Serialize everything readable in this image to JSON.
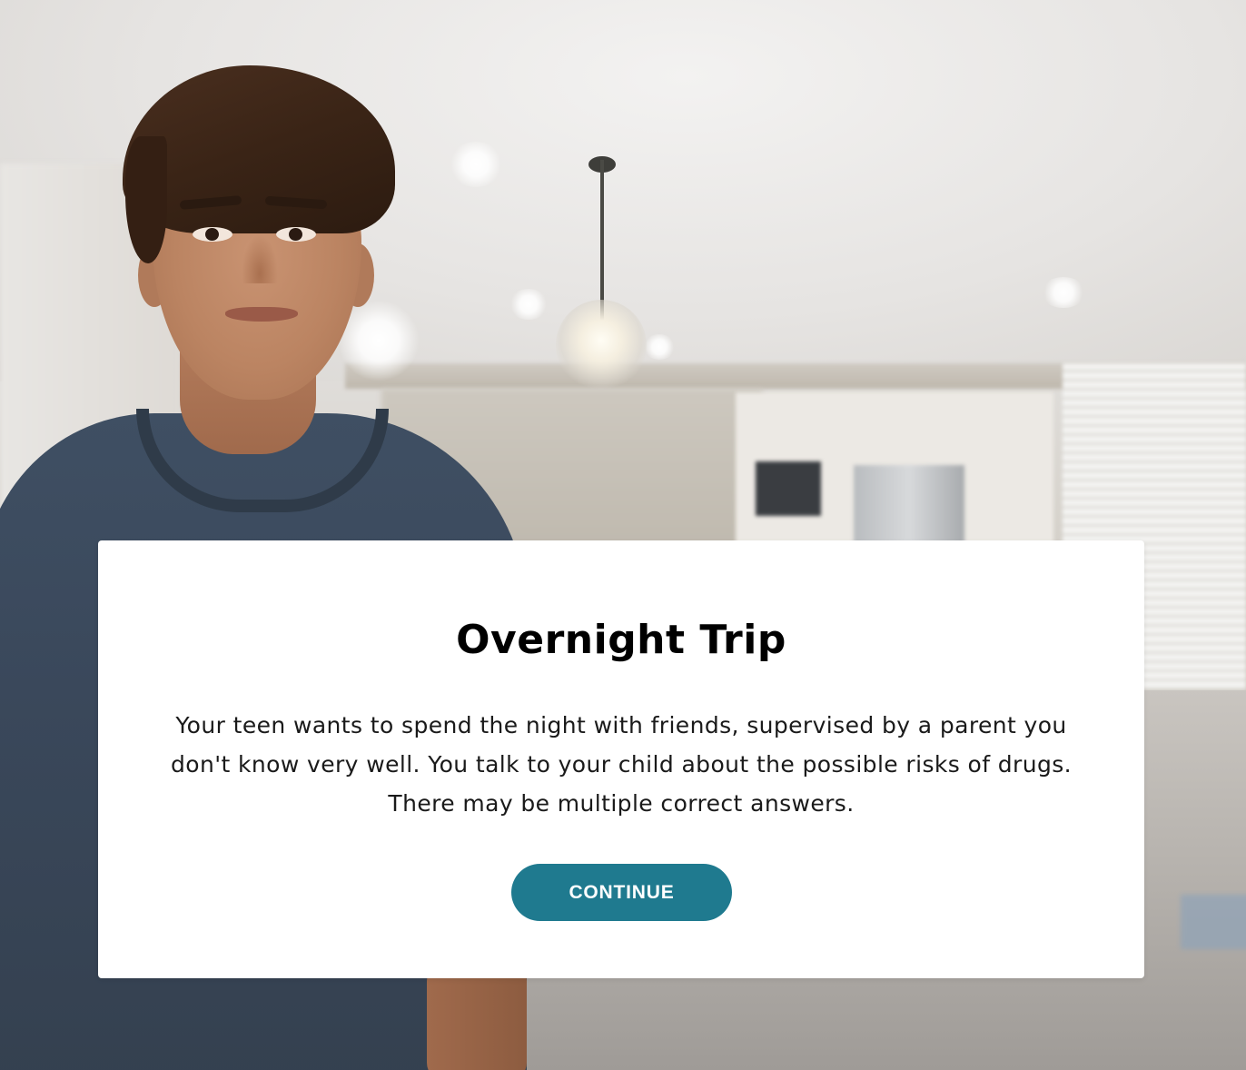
{
  "scene": {
    "background_image": "kitchen-interior",
    "character_image": "teen-boy"
  },
  "modal": {
    "title": "Overnight Trip",
    "body": "Your teen wants to spend the night with friends, supervised by a parent you don't know very well. You talk to your child about the possible risks of drugs. There may be multiple correct answers.",
    "continue_label": "CONTINUE"
  },
  "colors": {
    "button_bg": "#1f7a8f",
    "button_text": "#ffffff",
    "modal_bg": "#ffffff",
    "title_text": "#000000"
  }
}
